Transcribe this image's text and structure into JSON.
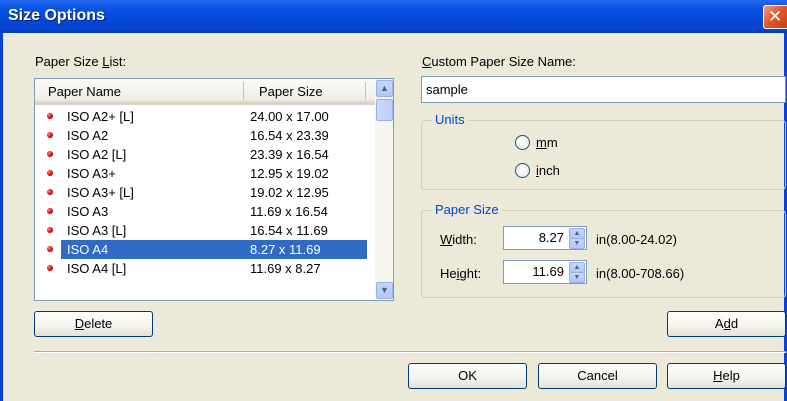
{
  "window": {
    "title": "Size Options",
    "close_glyph": "✕"
  },
  "list_label": {
    "prefix": "Paper Size ",
    "accel": "L",
    "suffix": "ist:"
  },
  "list": {
    "columns": [
      "Paper Name",
      "Paper Size"
    ],
    "rows": [
      {
        "name": "ISO A2+ [L]",
        "size": "24.00 x 17.00"
      },
      {
        "name": "ISO A2",
        "size": "16.54 x 23.39"
      },
      {
        "name": "ISO A2 [L]",
        "size": "23.39 x 16.54"
      },
      {
        "name": "ISO A3+",
        "size": "12.95 x 19.02"
      },
      {
        "name": "ISO A3+ [L]",
        "size": "19.02 x 12.95"
      },
      {
        "name": "ISO A3",
        "size": "11.69 x 16.54"
      },
      {
        "name": "ISO A3 [L]",
        "size": "16.54 x 11.69"
      },
      {
        "name": "ISO A4",
        "size": "8.27 x 11.69",
        "selected": true
      },
      {
        "name": "ISO A4 [L]",
        "size": "11.69 x 8.27"
      }
    ]
  },
  "delete_button": {
    "accel": "D",
    "rest": "elete"
  },
  "custom_name": {
    "label_accel": "C",
    "label_rest": "ustom Paper Size Name:",
    "value": "sample"
  },
  "units": {
    "title": "Units",
    "mm_accel": "m",
    "mm_rest": "m",
    "inch_accel": "i",
    "inch_rest": "nch"
  },
  "paper_size": {
    "title": "Paper Size",
    "width_accel": "W",
    "width_rest": "idth:",
    "width_value": "8.27",
    "width_range": "in(8.00-24.02)",
    "height_pre": "He",
    "height_accel": "i",
    "height_post": "ght:",
    "height_value": "11.69",
    "height_range": "in(8.00-708.66)"
  },
  "add_button": {
    "pre": "A",
    "accel": "d",
    "post": "d"
  },
  "ok_button": "OK",
  "cancel_button": "Cancel",
  "help_button": {
    "accel": "H",
    "rest": "elp"
  },
  "colors": {
    "title_bar": "#0348d6",
    "selection": "#316ac5",
    "group_title": "#0046d5",
    "bullet": "#e00000"
  }
}
